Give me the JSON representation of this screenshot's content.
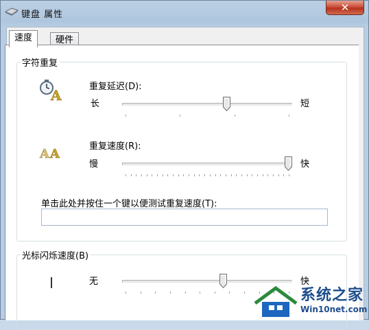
{
  "window": {
    "title": "键盘 属性",
    "close_glyph": "✕"
  },
  "tabs": [
    {
      "label": "速度",
      "active": true
    },
    {
      "label": "硬件",
      "active": false
    }
  ],
  "char_repeat": {
    "legend": "字符重复",
    "delay": {
      "label": "重复延迟(D):",
      "min_label": "长",
      "max_label": "短",
      "value": 0.62,
      "tick_count": 4
    },
    "rate": {
      "label": "重复速度(R):",
      "min_label": "慢",
      "max_label": "快",
      "value": 1.0,
      "tick_count": 32
    },
    "test_prompt": "单击此处并按住一个键以便测试重复速度(T):",
    "test_value": ""
  },
  "cursor_blink": {
    "legend": "光标闪烁速度(B)",
    "min_label": "无",
    "max_label": "快",
    "value": 0.6,
    "tick_count": 12
  },
  "watermark": {
    "line1": "系统之家",
    "line2": "Win10net.com"
  },
  "colors": {
    "accent": "#1d4d8c",
    "close": "#c9513c"
  }
}
